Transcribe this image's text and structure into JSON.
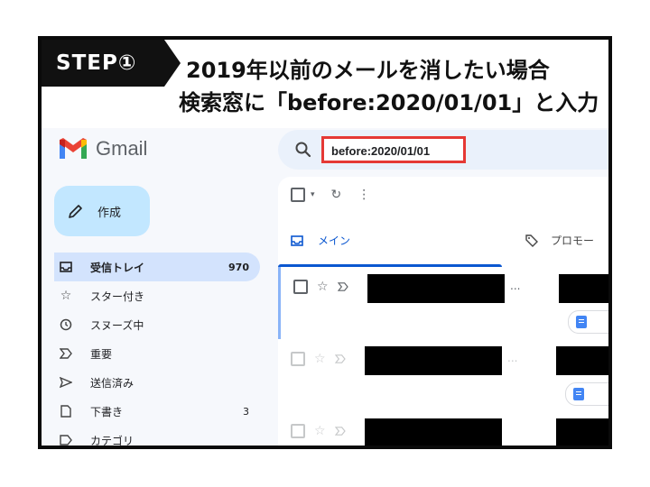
{
  "caption": {
    "step": "STEP①",
    "line1": "2019年以前のメールを消したい場合",
    "line2": "検索窓に「before:2020/01/01」と入力"
  },
  "app": {
    "name": "Gmail"
  },
  "search": {
    "query": "before:2020/01/01"
  },
  "compose": {
    "label": "作成"
  },
  "sidebar": {
    "items": [
      {
        "label": "受信トレイ",
        "count": "970",
        "icon": "inbox-icon"
      },
      {
        "label": "スター付き",
        "count": "",
        "icon": "star-icon"
      },
      {
        "label": "スヌーズ中",
        "count": "",
        "icon": "clock-icon"
      },
      {
        "label": "重要",
        "count": "",
        "icon": "important-icon"
      },
      {
        "label": "送信済み",
        "count": "",
        "icon": "send-icon"
      },
      {
        "label": "下書き",
        "count": "3",
        "icon": "draft-icon"
      },
      {
        "label": "カテゴリ",
        "count": "",
        "icon": "category-icon"
      }
    ]
  },
  "tabs": {
    "main": "メイン",
    "promotions": "プロモー"
  },
  "rows": {
    "ellipsis": "..."
  },
  "colors": {
    "highlight": "#e53935",
    "accent": "#0b57d0",
    "compose_bg": "#c2e7ff",
    "active_nav": "#d3e3fd"
  }
}
